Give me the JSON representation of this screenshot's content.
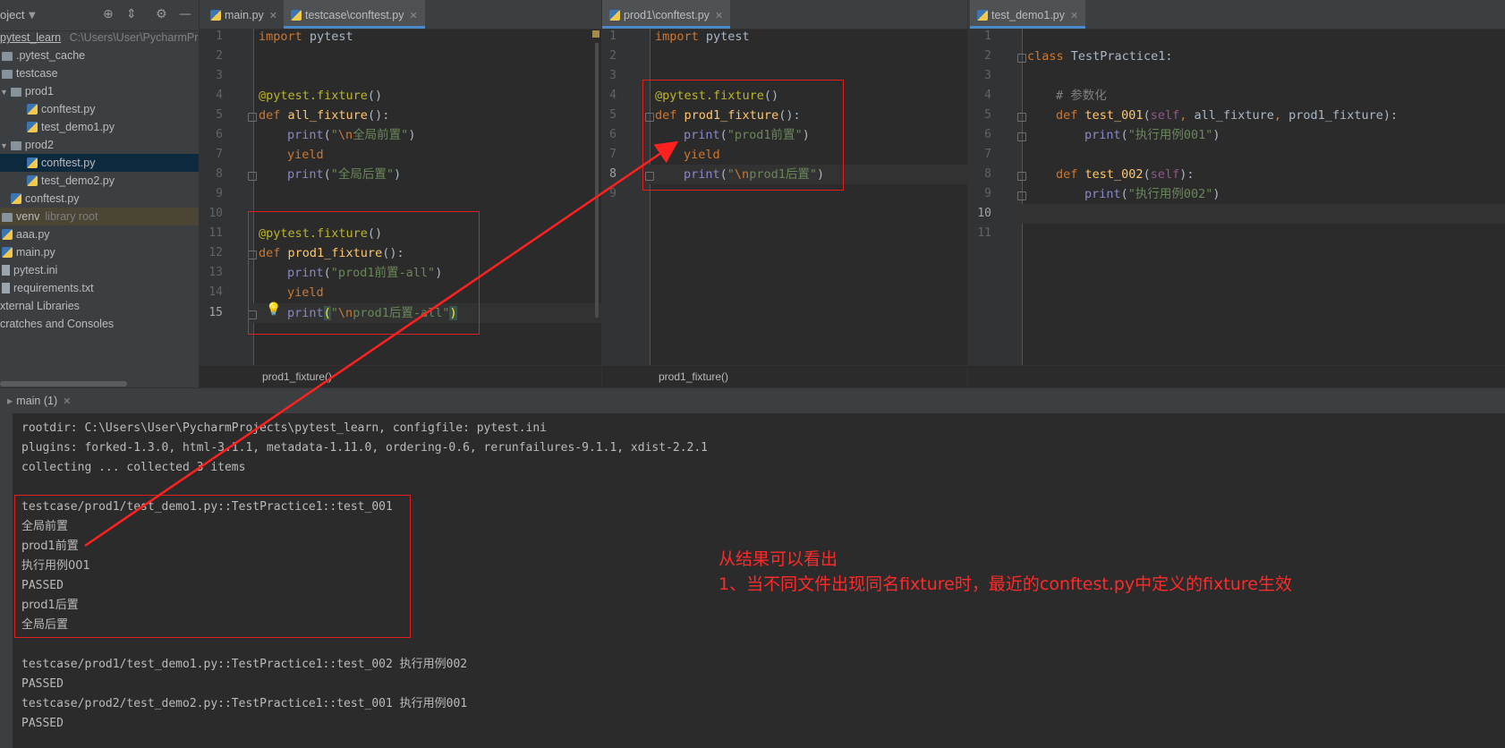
{
  "project": {
    "title": "oject",
    "root": "pytest_learn",
    "root_path": "C:\\Users\\User\\PycharmPr",
    "items": [
      {
        "label": ".pytest_cache",
        "type": "folder"
      },
      {
        "label": "testcase",
        "type": "folder"
      },
      {
        "label": "prod1",
        "type": "folder"
      },
      {
        "label": "conftest.py",
        "type": "py"
      },
      {
        "label": "test_demo1.py",
        "type": "py"
      },
      {
        "label": "prod2",
        "type": "folder"
      },
      {
        "label": "conftest.py",
        "type": "py",
        "selected": true
      },
      {
        "label": "test_demo2.py",
        "type": "py"
      },
      {
        "label": "conftest.py",
        "type": "py"
      },
      {
        "label": "venv",
        "type": "folder",
        "extra": "library root"
      },
      {
        "label": "aaa.py",
        "type": "py"
      },
      {
        "label": "main.py",
        "type": "py"
      },
      {
        "label": "pytest.ini",
        "type": "ini"
      },
      {
        "label": "requirements.txt",
        "type": "txt"
      },
      {
        "label": "xternal Libraries",
        "type": "lib"
      },
      {
        "label": "cratches and Consoles",
        "type": "lib"
      }
    ]
  },
  "editor1": {
    "tabs": [
      "main.py",
      "testcase\\conftest.py"
    ],
    "breadcrumb": "prod1_fixture()"
  },
  "editor2": {
    "tabs": [
      "prod1\\conftest.py"
    ],
    "breadcrumb": "prod1_fixture()"
  },
  "editor3": {
    "tabs": [
      "test_demo1.py"
    ]
  },
  "run": {
    "tab_label": "main (1)",
    "lines": [
      "rootdir: C:\\Users\\User\\PycharmProjects\\pytest_learn, configfile: pytest.ini",
      "plugins: forked-1.3.0, html-3.1.1, metadata-1.11.0, ordering-0.6, rerunfailures-9.1.1, xdist-2.2.1",
      "collecting ... collected 3 items",
      "",
      "testcase/prod1/test_demo1.py::TestPractice1::test_001",
      "全局前置",
      "prod1前置",
      "执行用例001",
      "PASSED",
      "prod1后置",
      "全局后置",
      "",
      "testcase/prod1/test_demo1.py::TestPractice1::test_002 执行用例002",
      "PASSED",
      "testcase/prod2/test_demo2.py::TestPractice1::test_001 执行用例001",
      "PASSED"
    ]
  },
  "annotation": {
    "line1": "从结果可以看出",
    "line2": "1、当不同文件出现同名fixture时，最近的conftest.py中定义的fixture生效"
  },
  "colors": {
    "accent": "#e02020",
    "keyword": "#cc7832",
    "decorator": "#bbb529",
    "string": "#6a8759",
    "function": "#ffc66d"
  }
}
